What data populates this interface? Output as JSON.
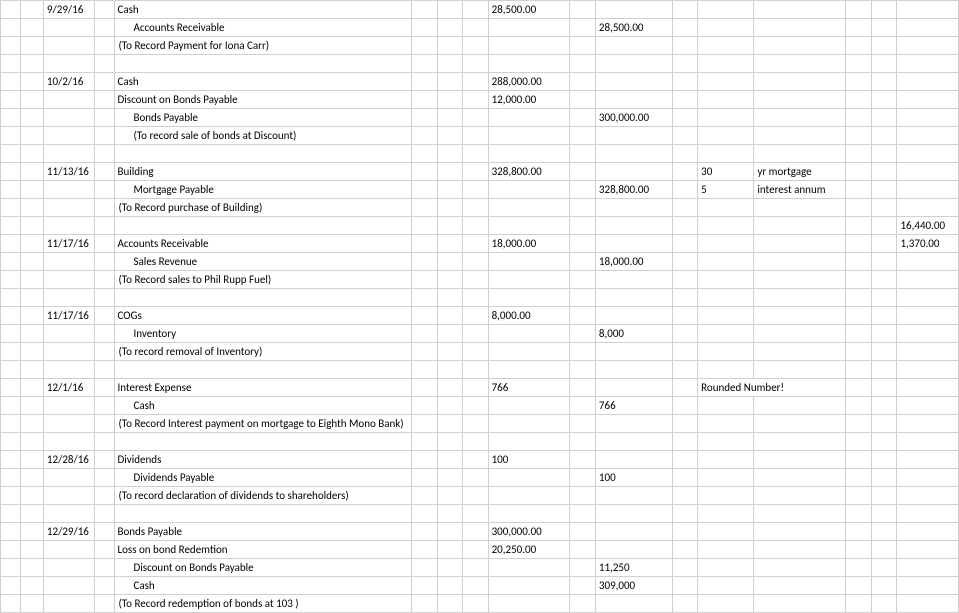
{
  "rows": [
    {
      "c": "9/29/16",
      "e": "Cash",
      "i": "28,500.00"
    },
    {
      "e": "Accounts Receivable",
      "indent": true,
      "k": "28,500.00"
    },
    {
      "e": "(To Record Payment for Iona Carr)"
    },
    {},
    {
      "c": "10/2/16",
      "e": "Cash",
      "i": "288,000.00"
    },
    {
      "e": "Discount on Bonds Payable",
      "i": "12,000.00"
    },
    {
      "e": "Bonds Payable",
      "indent": true,
      "k": "300,000.00"
    },
    {
      "e": "(To record sale of bonds at Discount)",
      "indent": true
    },
    {},
    {
      "c": "11/13/16",
      "e": "Building",
      "i": "328,800.00",
      "m": "30",
      "n": "yr mortgage"
    },
    {
      "e": "Mortgage Payable",
      "indent": true,
      "k": "328,800.00",
      "m": "5",
      "n": "interest annum"
    },
    {
      "e": "(To Record purchase of Building)"
    },
    {
      "q": "16,440.00"
    },
    {
      "c": "11/17/16",
      "e": "Accounts Receivable",
      "i": "18,000.00",
      "q": "1,370.00"
    },
    {
      "e": "Sales Revenue",
      "indent": true,
      "k": "18,000.00"
    },
    {
      "e": "(To Record sales to Phil Rupp Fuel)"
    },
    {},
    {
      "c": "11/17/16",
      "e": "COGs",
      "i": "8,000.00"
    },
    {
      "e": "Inventory",
      "indent": true,
      "k": "8,000"
    },
    {
      "e": "(To record removal of Inventory)"
    },
    {},
    {
      "c": "12/1/16",
      "e": "Interest Expense",
      "i": "766",
      "n": "Rounded Number!",
      "nspan": true
    },
    {
      "e": "Cash",
      "indent": true,
      "k": "766"
    },
    {
      "e": "(To Record Interest payment on mortgage to Eighth Mono Bank)"
    },
    {},
    {
      "c": "12/28/16",
      "e": "Dividends",
      "i": "100"
    },
    {
      "e": "Dividends Payable",
      "indent": true,
      "k": "100"
    },
    {
      "e": "(To record declaration of dividends to shareholders)"
    },
    {},
    {
      "c": "12/29/16",
      "e": "Bonds Payable",
      "i": "300,000.00"
    },
    {
      "e": "Loss on bond Redemtion",
      "i": "20,250.00"
    },
    {
      "e": "Discount on Bonds Payable",
      "indent": true,
      "k": "11,250"
    },
    {
      "e": "Cash",
      "indent": true,
      "k": "309,000"
    },
    {
      "e": "(To Record redemption of bonds at 103 )"
    }
  ]
}
